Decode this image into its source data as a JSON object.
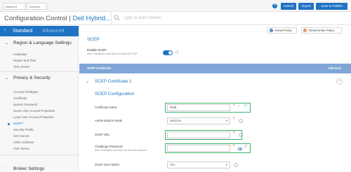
{
  "breadcrumbs": [
    "Default 0",
    "Devsure..."
  ],
  "toolbar": {
    "cancel_label": "Cancel",
    "import_label": "Import",
    "save_label": "Save & Publish"
  },
  "title": {
    "prefix": "Configuration Control | ",
    "highlight": "Dell Hybrid..."
  },
  "search": {
    "placeholder": "Type to start Search"
  },
  "tabs": {
    "standard": "Standard",
    "advanced": "Advanced"
  },
  "sidebar": {
    "region_section": "Region & Language Settings",
    "region_items": [
      "Language",
      "Region and Time",
      "Time Server"
    ],
    "privacy_section": "Privacy & Security",
    "privacy_items": [
      "Account Privileges",
      "Certificate",
      "System Password",
      "Guest User Account Properties",
      "Local User Account Properties",
      "SCEP *",
      "Security Profile",
      "SSH Server",
      "USB Lockdown",
      "VNC Server"
    ],
    "broker_section": "Broker Settings"
  },
  "main": {
    "reset_policy": "Reset Policy",
    "reset_entire_policy": "Reset Entire Policy",
    "scep_heading": "SCEP",
    "enable_label": "Enable SCEP",
    "enable_note": "Note: Clicking the reset does not reset the SCEP.",
    "cert_bar_label": "SCEP Certificate",
    "add_row": "Add Row",
    "cert1_label": "SCEP Certificate 1",
    "config_heading": "SCEP Configuration",
    "fields": {
      "certificate_name_label": "Certificate Name",
      "certificate_name_value": "Gstd",
      "auth_mode_label": "Authentication Mode",
      "auth_mode_value": "Machine",
      "scep_url_label": "SCEP URL",
      "challenge_label": "Challenge Password",
      "challenge_note": "Note: Clicking the reset does not reset the password.",
      "ndes_label": "SCEP Over NDES",
      "ndes_value": "Yes"
    }
  },
  "colors": {
    "accent": "#1f73c4",
    "highlight_box": "#3db26a",
    "required": "#c62828",
    "orange": "#e8772e"
  }
}
